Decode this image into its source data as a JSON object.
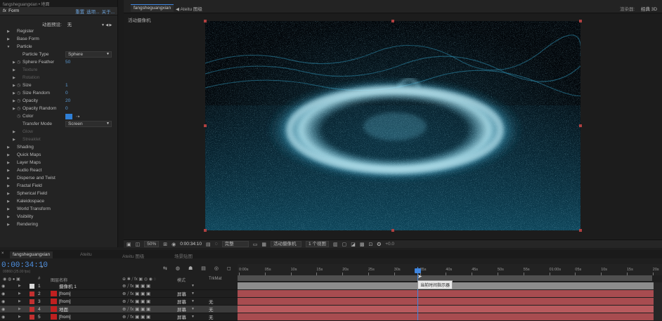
{
  "effect_controls": {
    "top_tab": "fangsheguangxian • 地面",
    "fx_label": "fx",
    "effect_name": "Form",
    "reset": "重置",
    "options": "选项...",
    "about": "关于...",
    "animation_presets_label": "动画预设:",
    "animation_presets_value": "无",
    "rows": [
      {
        "label": "Register",
        "indent": 1,
        "arrow": "▶"
      },
      {
        "label": "Base Form",
        "indent": 1,
        "arrow": "▶"
      },
      {
        "label": "Particle",
        "indent": 1,
        "arrow": "▼"
      },
      {
        "label": "Particle Type",
        "indent": 3,
        "arrow": "",
        "dropdown": "Sphere"
      },
      {
        "label": "Sphere Feather",
        "indent": 3,
        "arrow": "▶",
        "sw": true,
        "value": "50"
      },
      {
        "label": "Texture",
        "indent": 3,
        "arrow": "▶",
        "dim": true
      },
      {
        "label": "Rotation",
        "indent": 3,
        "arrow": "▶",
        "dim": true
      },
      {
        "label": "Size",
        "indent": 3,
        "arrow": "▶",
        "sw": true,
        "value": "1"
      },
      {
        "label": "Size Random",
        "indent": 3,
        "arrow": "▶",
        "sw": true,
        "value": "0"
      },
      {
        "label": "Opacity",
        "indent": 3,
        "arrow": "▶",
        "sw": true,
        "value": "20"
      },
      {
        "label": "Opacity Random",
        "indent": 3,
        "arrow": "▶",
        "sw": true,
        "value": "0"
      },
      {
        "label": "Color",
        "indent": 3,
        "arrow": "",
        "sw": true,
        "color": "#2f7fd6"
      },
      {
        "label": "Transfer Mode",
        "indent": 3,
        "arrow": "",
        "dropdown": "Screen"
      },
      {
        "label": "Glow",
        "indent": 3,
        "arrow": "▶",
        "dim": true
      },
      {
        "label": "Streaklet",
        "indent": 3,
        "arrow": "▶",
        "dim": true
      },
      {
        "label": "Shading",
        "indent": 1,
        "arrow": "▶"
      },
      {
        "label": "Quick Maps",
        "indent": 1,
        "arrow": "▶"
      },
      {
        "label": "Layer Maps",
        "indent": 1,
        "arrow": "▶"
      },
      {
        "label": "Audio React",
        "indent": 1,
        "arrow": "▶"
      },
      {
        "label": "Disperse and Twist",
        "indent": 1,
        "arrow": "▶"
      },
      {
        "label": "Fractal Field",
        "indent": 1,
        "arrow": "▶"
      },
      {
        "label": "Spherical Field",
        "indent": 1,
        "arrow": "▶"
      },
      {
        "label": "Kaleidospace",
        "indent": 1,
        "arrow": "▶"
      },
      {
        "label": "World Transform",
        "indent": 1,
        "arrow": "▶"
      },
      {
        "label": "Visibility",
        "indent": 1,
        "arrow": "▶"
      },
      {
        "label": "Rendering",
        "indent": 1,
        "arrow": "▶"
      }
    ]
  },
  "viewer": {
    "tab_active": "fangsheguangxian",
    "tab_other": "Ateitu 图级",
    "renderer_label": "渲染器:",
    "renderer_value": "经典 3D",
    "camera_label": "活动摄像机",
    "zoom": "50%",
    "timecode": "0:00:34:10",
    "quality": "完整",
    "camera": "活动摄像机",
    "views": "1 个视图",
    "exposure": "+0.0"
  },
  "timeline": {
    "tabs": [
      "fangsheguangxian",
      "Ateitu",
      "Ateitu 图级",
      "场景贴图"
    ],
    "timecode": "0:00:34:10",
    "timecode_sub": "00860 (25.00 fps)",
    "columns": {
      "num": "#",
      "name": "图层名称",
      "mode": "模式",
      "trkmat": "TrkMat"
    },
    "ruler": [
      "0:00s",
      "05s",
      "10s",
      "15s",
      "20s",
      "25s",
      "30s",
      "35s",
      "40s",
      "45s",
      "50s",
      "55s",
      "01:00s",
      "05s",
      "10s",
      "15s",
      "20s"
    ],
    "tooltip": "当前时间指示器",
    "layers": [
      {
        "num": "1",
        "name": "摄像机 1",
        "mode": "",
        "trkmat": "",
        "label_color": "#d9d9d9",
        "track_color": "#8c8c8c",
        "selected": false
      },
      {
        "num": "2",
        "name": "[from]",
        "mode": "屏幕",
        "trkmat": "",
        "label_color": "#c23030",
        "track_color": "#a84c50",
        "selected": false
      },
      {
        "num": "3",
        "name": "[from]",
        "mode": "屏幕",
        "trkmat": "无",
        "label_color": "#c23030",
        "track_color": "#a84c50",
        "selected": false
      },
      {
        "num": "4",
        "name": "地面",
        "mode": "屏幕",
        "trkmat": "无",
        "label_color": "#c23030",
        "track_color": "#b85a5e",
        "selected": true
      },
      {
        "num": "5",
        "name": "[from]",
        "mode": "屏幕",
        "trkmat": "无",
        "label_color": "#c23030",
        "track_color": "#a84c50",
        "selected": false
      }
    ]
  }
}
